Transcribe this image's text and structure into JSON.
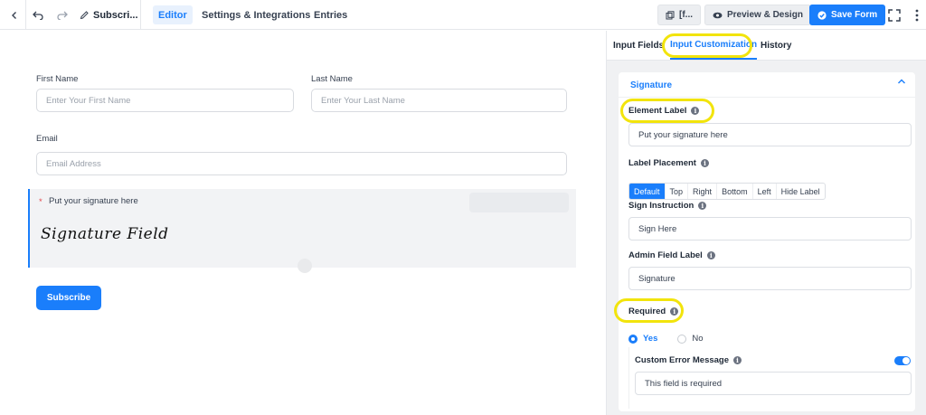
{
  "topbar": {
    "form_title": "Subscri...",
    "tabs": [
      {
        "label": "Editor",
        "active": true
      },
      {
        "label": "Settings & Integrations",
        "active": false
      },
      {
        "label": "Entries",
        "active": false
      }
    ],
    "shortcode_label": "[f...",
    "preview_label": "Preview & Design",
    "save_label": "Save Form"
  },
  "form": {
    "first_name": {
      "label": "First Name",
      "placeholder": "Enter Your First Name"
    },
    "last_name": {
      "label": "Last Name",
      "placeholder": "Enter Your Last Name"
    },
    "email": {
      "label": "Email",
      "placeholder": "Email Address"
    },
    "signature": {
      "required_mark": "*",
      "label": "Put your signature here",
      "field_text": "Signature Field"
    },
    "submit_label": "Subscribe"
  },
  "panel": {
    "tabs": [
      {
        "label": "Input Fields",
        "active": false
      },
      {
        "label": "Input Customization",
        "active": true
      },
      {
        "label": "History",
        "active": false
      }
    ],
    "section_title": "Signature",
    "element_label": {
      "label": "Element Label",
      "value": "Put your signature here"
    },
    "label_placement": {
      "label": "Label Placement",
      "options": [
        "Default",
        "Top",
        "Right",
        "Bottom",
        "Left",
        "Hide Label"
      ],
      "selected": "Default"
    },
    "sign_instruction": {
      "label": "Sign Instruction",
      "value": "Sign Here"
    },
    "admin_field_label": {
      "label": "Admin Field Label",
      "value": "Signature"
    },
    "required": {
      "label": "Required",
      "yes": "Yes",
      "no": "No",
      "selected": "Yes"
    },
    "custom_error": {
      "label": "Custom Error Message",
      "enabled": true,
      "value": "This field is required"
    }
  },
  "colors": {
    "accent": "#1a7efb",
    "highlight": "#f2e40c",
    "required": "#e5484d"
  }
}
